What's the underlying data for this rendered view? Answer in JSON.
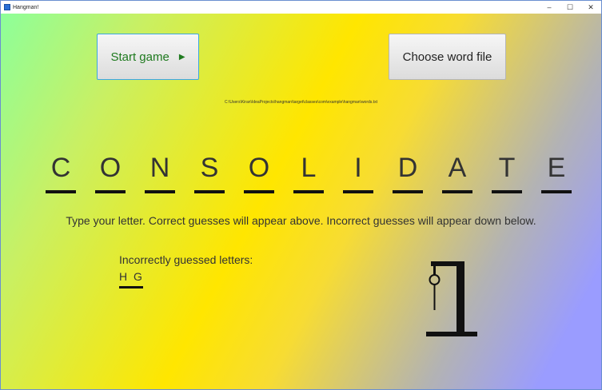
{
  "window": {
    "title": "Hangman!",
    "controls": [
      "–",
      "☐",
      "✕"
    ]
  },
  "buttons": {
    "start": "Start game",
    "start_arrow": "▶",
    "choose": "Choose word file"
  },
  "file_path": "C:\\Users\\Kiran\\IdeaProjects\\hangman\\target\\classes\\com\\example\\hangman\\words.txt",
  "word_letters": [
    "C",
    "O",
    "N",
    "S",
    "O",
    "L",
    "I",
    "D",
    "A",
    "T",
    "E"
  ],
  "instructions": "Type your letter. Correct guesses will appear above. Incorrect guesses will appear down below.",
  "incorrect": {
    "label": "Incorrectly guessed letters:",
    "letters": "H G"
  },
  "hangman": {
    "wrong_count": 2,
    "stage": "gallows-head-body"
  }
}
